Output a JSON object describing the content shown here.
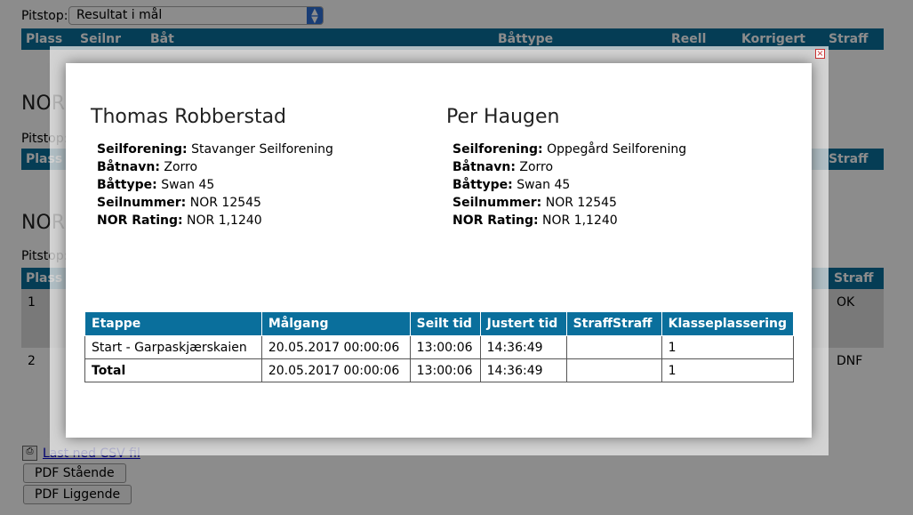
{
  "background": {
    "pitstop_label": "Pitstop:",
    "pitstop_select_value": "Resultat i mål",
    "header_columns": [
      "Plass",
      "Seilnr",
      "Båt",
      "Båttype",
      "Reell",
      "Korrigert",
      "Straff"
    ],
    "section_prefix": "NOR",
    "rows": [
      {
        "plass": "1",
        "straff": "OK"
      },
      {
        "plass": "2",
        "straff": "DNF"
      }
    ],
    "csv_link": "Last ned CSV fil",
    "pdf_portrait": "PDF Stående",
    "pdf_landscape": "PDF Liggende"
  },
  "modal": {
    "close_icon": "close-icon",
    "persons": [
      {
        "name": "Thomas Robberstad",
        "fields": [
          {
            "label": "Seilforening:",
            "value": "Stavanger Seilforening"
          },
          {
            "label": "Båtnavn:",
            "value": "Zorro"
          },
          {
            "label": "Båttype:",
            "value": "Swan 45"
          },
          {
            "label": "Seilnummer:",
            "value": "NOR 12545"
          },
          {
            "label": "NOR Rating:",
            "value": "NOR 1,1240"
          }
        ]
      },
      {
        "name": "Per Haugen",
        "fields": [
          {
            "label": "Seilforening:",
            "value": "Oppegård Seilforening"
          },
          {
            "label": "Båtnavn:",
            "value": "Zorro"
          },
          {
            "label": "Båttype:",
            "value": "Swan 45"
          },
          {
            "label": "Seilnummer:",
            "value": "NOR 12545"
          },
          {
            "label": "NOR Rating:",
            "value": "NOR 1,1240"
          }
        ]
      }
    ],
    "table": {
      "headers": [
        "Etappe",
        "Målgang",
        "Seilt tid",
        "Justert tid",
        "StraffStraff",
        "Klasseplassering"
      ],
      "rows": [
        [
          "Start - Garpaskjærskaien",
          "20.05.2017 00:00:06",
          "13:00:06",
          "14:36:49",
          "",
          "1"
        ],
        [
          "Total",
          "20.05.2017 00:00:06",
          "13:00:06",
          "14:36:49",
          "",
          "1"
        ]
      ]
    }
  }
}
